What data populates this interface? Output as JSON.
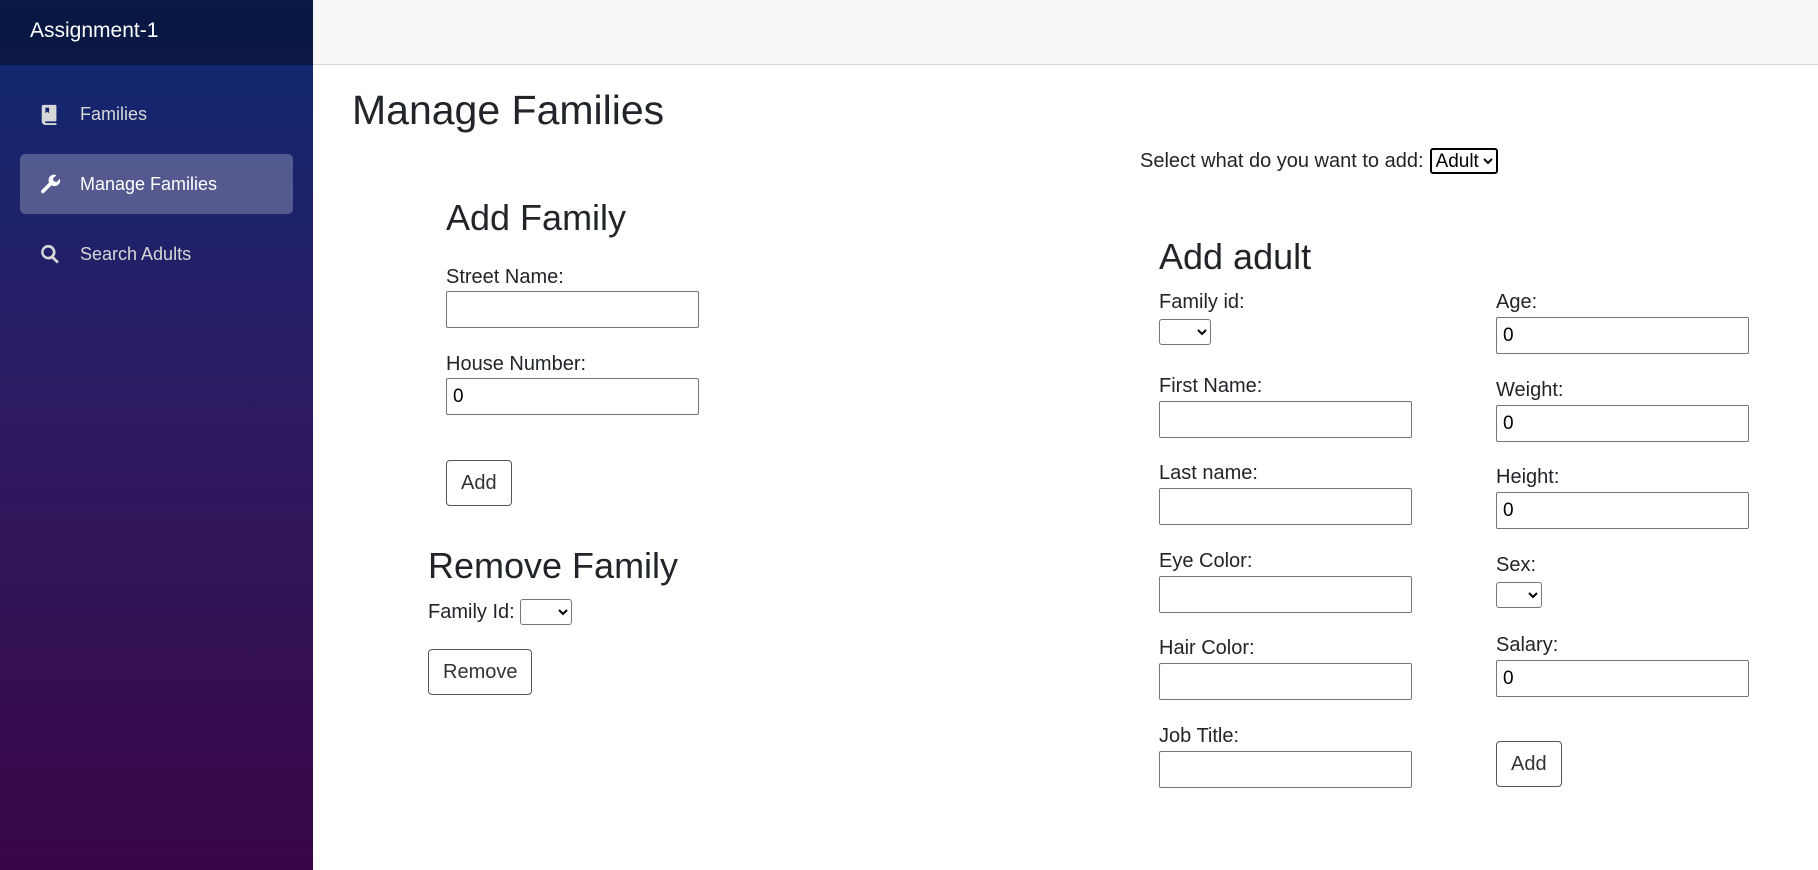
{
  "app": {
    "brand": "Assignment-1"
  },
  "sidebar": {
    "items": [
      {
        "label": "Families",
        "icon": "book-icon",
        "active": false
      },
      {
        "label": "Manage Families",
        "icon": "wrench-icon",
        "active": true
      },
      {
        "label": "Search Adults",
        "icon": "search-icon",
        "active": false
      }
    ]
  },
  "page": {
    "title": "Manage Families"
  },
  "add_type": {
    "label": "Select what do you want to add:",
    "selected": "Adult"
  },
  "add_family": {
    "title": "Add Family",
    "street_label": "Street Name:",
    "street_value": "",
    "house_label": "House Number:",
    "house_value": "0",
    "add_button": "Add"
  },
  "remove_family": {
    "title": "Remove Family",
    "family_id_label": "Family Id:",
    "family_id_value": "",
    "remove_button": "Remove"
  },
  "add_adult": {
    "title": "Add adult",
    "family_id_label": "Family id:",
    "family_id_value": "",
    "first_name_label": "First Name:",
    "first_name_value": "",
    "last_name_label": "Last name:",
    "last_name_value": "",
    "eye_color_label": "Eye Color:",
    "eye_color_value": "",
    "hair_color_label": "Hair Color:",
    "hair_color_value": "",
    "job_title_label": "Job Title:",
    "job_title_value": "",
    "age_label": "Age:",
    "age_value": "0",
    "weight_label": "Weight:",
    "weight_value": "0",
    "height_label": "Height:",
    "height_value": "0",
    "sex_label": "Sex:",
    "sex_value": "",
    "salary_label": "Salary:",
    "salary_value": "0",
    "add_button": "Add"
  }
}
